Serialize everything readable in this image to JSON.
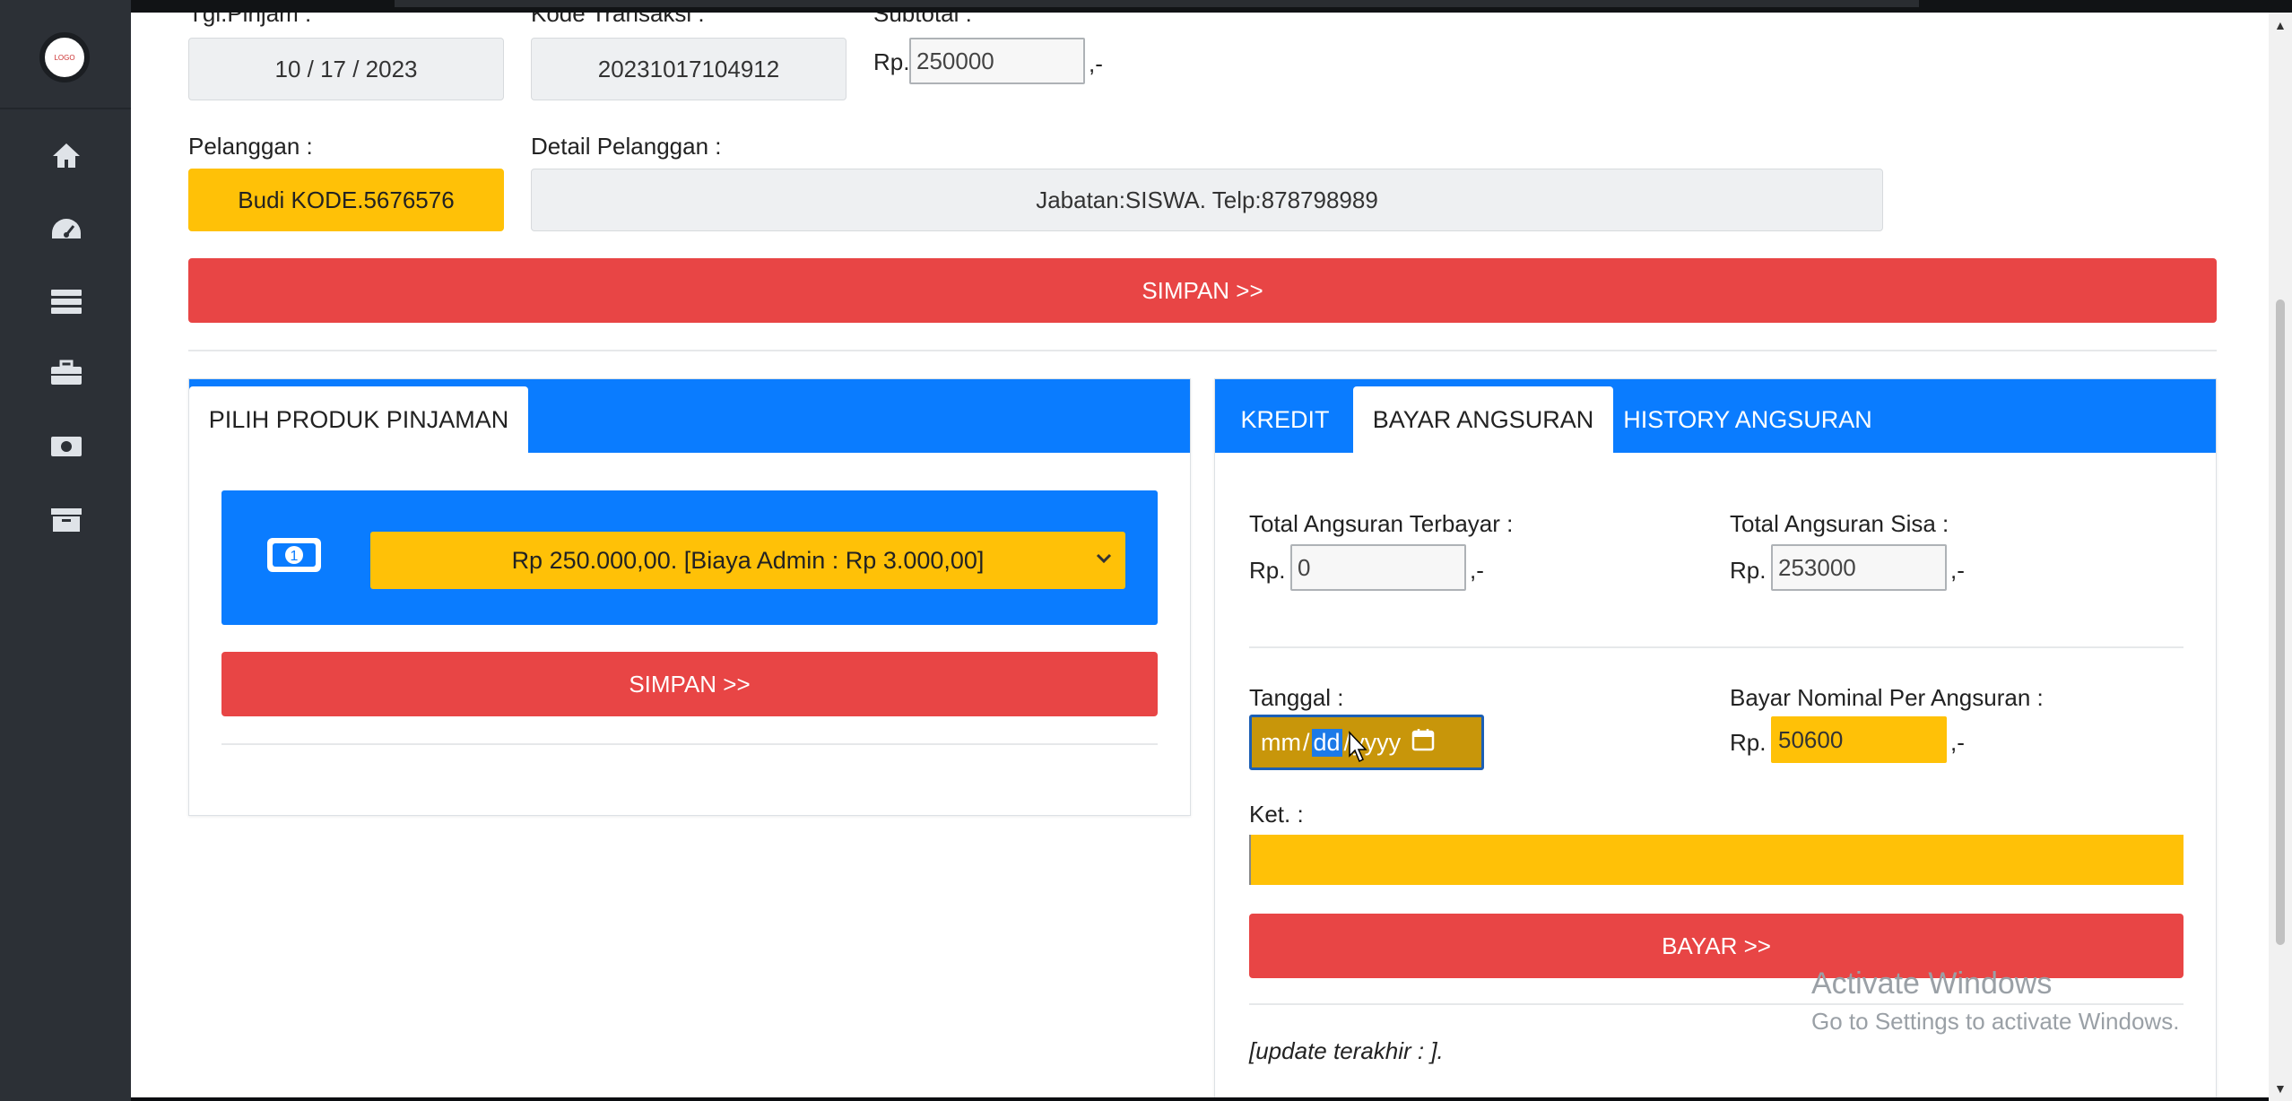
{
  "sidebar": {
    "logo_text": "LOGO",
    "icons": [
      "home-icon",
      "dashboard-icon",
      "server-icon",
      "briefcase-icon",
      "money-icon",
      "archive-icon"
    ]
  },
  "form": {
    "tgl_label": "Tgl.Pinjam :",
    "tgl_value": "10 / 17 / 2023",
    "kode_label": "Kode Transaksi :",
    "kode_value": "20231017104912",
    "subtotal_label": "Subtotal :",
    "subtotal_prefix": "Rp.",
    "subtotal_value": "250000",
    "subtotal_suffix": ",-",
    "pelanggan_label": "Pelanggan :",
    "pelanggan_value": "Budi KODE.5676576",
    "detail_label": "Detail Pelanggan :",
    "detail_value": "Jabatan:SISWA. Telp:878798989",
    "simpan_label": "SIMPAN >>"
  },
  "produk_card": {
    "tab_label": "PILIH PRODUK PINJAMAN",
    "select_value": "Rp 250.000,00. [Biaya Admin : Rp 3.000,00]",
    "simpan_label": "SIMPAN >>"
  },
  "angsuran_card": {
    "tabs": [
      "KREDIT",
      "BAYAR ANGSURAN",
      "HISTORY ANGSURAN"
    ],
    "active_tab": "BAYAR ANGSURAN",
    "terbayar_label": "Total Angsuran Terbayar :",
    "terbayar_value": "0",
    "sisa_label": "Total Angsuran Sisa :",
    "sisa_value": "253000",
    "rp_prefix": "Rp.",
    "suffix": ",-",
    "tanggal_label": "Tanggal :",
    "date_mm": "mm",
    "date_dd": "dd",
    "date_yyyy": "yyyy",
    "date_sep": "/",
    "nominal_label": "Bayar Nominal Per Angsuran :",
    "nominal_value": "50600",
    "ket_label": "Ket. :",
    "ket_value": "",
    "bayar_label": "BAYAR >>",
    "update_text": "[update terakhir : ]."
  },
  "watermark": {
    "title": "Activate Windows",
    "subtitle": "Go to Settings to activate Windows."
  },
  "colors": {
    "primary": "#0a7cff",
    "danger": "#e84545",
    "warning": "#ffc107",
    "sidebar": "#2c3036"
  }
}
